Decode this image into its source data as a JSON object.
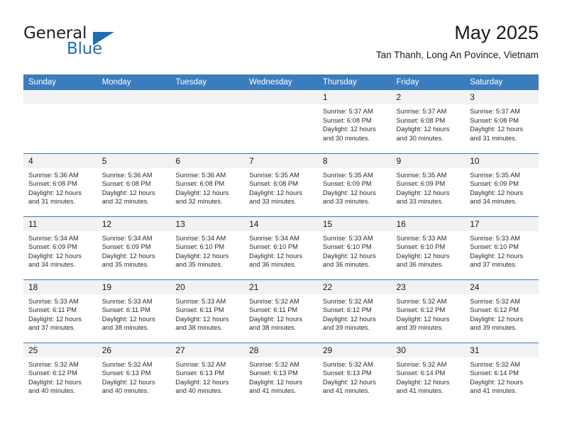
{
  "brand": {
    "word1": "General",
    "word2": "Blue",
    "triangle_color": "#1f6eb5"
  },
  "header": {
    "title": "May 2025",
    "subtitle": "Tan Thanh, Long An Povince, Vietnam",
    "header_bg": "#3b7cbd",
    "daynum_bg": "#f2f2f2"
  },
  "weekdays": [
    "Sunday",
    "Monday",
    "Tuesday",
    "Wednesday",
    "Thursday",
    "Friday",
    "Saturday"
  ],
  "labels": {
    "sunrise_prefix": "Sunrise: ",
    "sunset_prefix": "Sunset: ",
    "daylight_prefix": "Daylight: "
  },
  "weeks": [
    [
      {
        "day": "",
        "empty": true
      },
      {
        "day": "",
        "empty": true
      },
      {
        "day": "",
        "empty": true
      },
      {
        "day": "",
        "empty": true
      },
      {
        "day": "1",
        "sunrise": "Sunrise: 5:37 AM",
        "sunset": "Sunset: 6:08 PM",
        "daylight_l1": "Daylight: 12 hours",
        "daylight_l2": "and 30 minutes."
      },
      {
        "day": "2",
        "sunrise": "Sunrise: 5:37 AM",
        "sunset": "Sunset: 6:08 PM",
        "daylight_l1": "Daylight: 12 hours",
        "daylight_l2": "and 30 minutes."
      },
      {
        "day": "3",
        "sunrise": "Sunrise: 5:37 AM",
        "sunset": "Sunset: 6:08 PM",
        "daylight_l1": "Daylight: 12 hours",
        "daylight_l2": "and 31 minutes."
      }
    ],
    [
      {
        "day": "4",
        "sunrise": "Sunrise: 5:36 AM",
        "sunset": "Sunset: 6:08 PM",
        "daylight_l1": "Daylight: 12 hours",
        "daylight_l2": "and 31 minutes."
      },
      {
        "day": "5",
        "sunrise": "Sunrise: 5:36 AM",
        "sunset": "Sunset: 6:08 PM",
        "daylight_l1": "Daylight: 12 hours",
        "daylight_l2": "and 32 minutes."
      },
      {
        "day": "6",
        "sunrise": "Sunrise: 5:36 AM",
        "sunset": "Sunset: 6:08 PM",
        "daylight_l1": "Daylight: 12 hours",
        "daylight_l2": "and 32 minutes."
      },
      {
        "day": "7",
        "sunrise": "Sunrise: 5:35 AM",
        "sunset": "Sunset: 6:08 PM",
        "daylight_l1": "Daylight: 12 hours",
        "daylight_l2": "and 33 minutes."
      },
      {
        "day": "8",
        "sunrise": "Sunrise: 5:35 AM",
        "sunset": "Sunset: 6:09 PM",
        "daylight_l1": "Daylight: 12 hours",
        "daylight_l2": "and 33 minutes."
      },
      {
        "day": "9",
        "sunrise": "Sunrise: 5:35 AM",
        "sunset": "Sunset: 6:09 PM",
        "daylight_l1": "Daylight: 12 hours",
        "daylight_l2": "and 33 minutes."
      },
      {
        "day": "10",
        "sunrise": "Sunrise: 5:35 AM",
        "sunset": "Sunset: 6:09 PM",
        "daylight_l1": "Daylight: 12 hours",
        "daylight_l2": "and 34 minutes."
      }
    ],
    [
      {
        "day": "11",
        "sunrise": "Sunrise: 5:34 AM",
        "sunset": "Sunset: 6:09 PM",
        "daylight_l1": "Daylight: 12 hours",
        "daylight_l2": "and 34 minutes."
      },
      {
        "day": "12",
        "sunrise": "Sunrise: 5:34 AM",
        "sunset": "Sunset: 6:09 PM",
        "daylight_l1": "Daylight: 12 hours",
        "daylight_l2": "and 35 minutes."
      },
      {
        "day": "13",
        "sunrise": "Sunrise: 5:34 AM",
        "sunset": "Sunset: 6:10 PM",
        "daylight_l1": "Daylight: 12 hours",
        "daylight_l2": "and 35 minutes."
      },
      {
        "day": "14",
        "sunrise": "Sunrise: 5:34 AM",
        "sunset": "Sunset: 6:10 PM",
        "daylight_l1": "Daylight: 12 hours",
        "daylight_l2": "and 36 minutes."
      },
      {
        "day": "15",
        "sunrise": "Sunrise: 5:33 AM",
        "sunset": "Sunset: 6:10 PM",
        "daylight_l1": "Daylight: 12 hours",
        "daylight_l2": "and 36 minutes."
      },
      {
        "day": "16",
        "sunrise": "Sunrise: 5:33 AM",
        "sunset": "Sunset: 6:10 PM",
        "daylight_l1": "Daylight: 12 hours",
        "daylight_l2": "and 36 minutes."
      },
      {
        "day": "17",
        "sunrise": "Sunrise: 5:33 AM",
        "sunset": "Sunset: 6:10 PM",
        "daylight_l1": "Daylight: 12 hours",
        "daylight_l2": "and 37 minutes."
      }
    ],
    [
      {
        "day": "18",
        "sunrise": "Sunrise: 5:33 AM",
        "sunset": "Sunset: 6:11 PM",
        "daylight_l1": "Daylight: 12 hours",
        "daylight_l2": "and 37 minutes."
      },
      {
        "day": "19",
        "sunrise": "Sunrise: 5:33 AM",
        "sunset": "Sunset: 6:11 PM",
        "daylight_l1": "Daylight: 12 hours",
        "daylight_l2": "and 38 minutes."
      },
      {
        "day": "20",
        "sunrise": "Sunrise: 5:33 AM",
        "sunset": "Sunset: 6:11 PM",
        "daylight_l1": "Daylight: 12 hours",
        "daylight_l2": "and 38 minutes."
      },
      {
        "day": "21",
        "sunrise": "Sunrise: 5:32 AM",
        "sunset": "Sunset: 6:11 PM",
        "daylight_l1": "Daylight: 12 hours",
        "daylight_l2": "and 38 minutes."
      },
      {
        "day": "22",
        "sunrise": "Sunrise: 5:32 AM",
        "sunset": "Sunset: 6:12 PM",
        "daylight_l1": "Daylight: 12 hours",
        "daylight_l2": "and 39 minutes."
      },
      {
        "day": "23",
        "sunrise": "Sunrise: 5:32 AM",
        "sunset": "Sunset: 6:12 PM",
        "daylight_l1": "Daylight: 12 hours",
        "daylight_l2": "and 39 minutes."
      },
      {
        "day": "24",
        "sunrise": "Sunrise: 5:32 AM",
        "sunset": "Sunset: 6:12 PM",
        "daylight_l1": "Daylight: 12 hours",
        "daylight_l2": "and 39 minutes."
      }
    ],
    [
      {
        "day": "25",
        "sunrise": "Sunrise: 5:32 AM",
        "sunset": "Sunset: 6:12 PM",
        "daylight_l1": "Daylight: 12 hours",
        "daylight_l2": "and 40 minutes."
      },
      {
        "day": "26",
        "sunrise": "Sunrise: 5:32 AM",
        "sunset": "Sunset: 6:13 PM",
        "daylight_l1": "Daylight: 12 hours",
        "daylight_l2": "and 40 minutes."
      },
      {
        "day": "27",
        "sunrise": "Sunrise: 5:32 AM",
        "sunset": "Sunset: 6:13 PM",
        "daylight_l1": "Daylight: 12 hours",
        "daylight_l2": "and 40 minutes."
      },
      {
        "day": "28",
        "sunrise": "Sunrise: 5:32 AM",
        "sunset": "Sunset: 6:13 PM",
        "daylight_l1": "Daylight: 12 hours",
        "daylight_l2": "and 41 minutes."
      },
      {
        "day": "29",
        "sunrise": "Sunrise: 5:32 AM",
        "sunset": "Sunset: 6:13 PM",
        "daylight_l1": "Daylight: 12 hours",
        "daylight_l2": "and 41 minutes."
      },
      {
        "day": "30",
        "sunrise": "Sunrise: 5:32 AM",
        "sunset": "Sunset: 6:14 PM",
        "daylight_l1": "Daylight: 12 hours",
        "daylight_l2": "and 41 minutes."
      },
      {
        "day": "31",
        "sunrise": "Sunrise: 5:32 AM",
        "sunset": "Sunset: 6:14 PM",
        "daylight_l1": "Daylight: 12 hours",
        "daylight_l2": "and 41 minutes."
      }
    ]
  ]
}
